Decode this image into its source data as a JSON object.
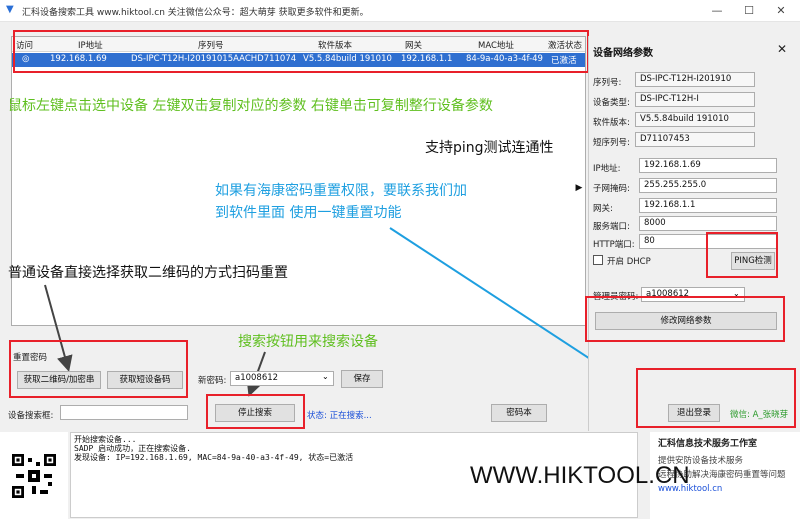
{
  "window": {
    "title": "汇科设备搜索工具  www.hiktool.cn  关注微信公众号：超大萌芽  获取更多软件和更新。",
    "minimize": "—",
    "maximize": "☐",
    "close": "✕"
  },
  "grid": {
    "columns": [
      "访问",
      "IP地址",
      "序列号",
      "软件版本",
      "网关",
      "MAC地址",
      "激活状态"
    ],
    "rows": [
      {
        "access": "◎",
        "ip": "192.168.1.69",
        "serial": "DS-IPC-T12H-I20191015AACHD711074",
        "version": "V5.5.84build 191010",
        "gateway": "192.168.1.1",
        "mac": "84-9a-40-a3-4f-49",
        "status": "已激活"
      }
    ]
  },
  "annotations": {
    "select_hint": "鼠标左键点击选中设备   左键双击复制对应的参数   右键单击可复制整行设备参数",
    "ping_hint": "支持ping测试连通性",
    "reset_hint_line1": "如果有海康密码重置权限，要联系我们加",
    "reset_hint_line2": "到软件里面  使用一键重置功能",
    "qr_hint": "普通设备直接选择获取二维码的方式扫码重置",
    "search_hint": "搜索按钮用来搜索设备",
    "watermark": "WWW.HIKTOOL.CN"
  },
  "panel": {
    "title": "设备网络参数",
    "close": "✕",
    "serial_label": "序列号:",
    "serial_value": "DS-IPC-T12H-I201910",
    "type_label": "设备类型:",
    "type_value": "DS-IPC-T12H-I",
    "version_label": "软件版本:",
    "version_value": "V5.5.84build 191010",
    "short_serial_label": "短序列号:",
    "short_serial_value": "D71107453",
    "ip_label": "IP地址:",
    "ip_value": "192.168.1.69",
    "mask_label": "子网掩码:",
    "mask_value": "255.255.255.0",
    "gateway_label": "网关:",
    "gateway_value": "192.168.1.1",
    "port_label": "服务端口:",
    "port_value": "8000",
    "http_label": "HTTP端口:",
    "http_value": "80",
    "dhcp_label": "开启 DHCP",
    "ping_button": "PING检测",
    "admin_pwd_label": "管理员密码:",
    "admin_pwd_value": "a1008612",
    "modify_button": "修改网络参数",
    "expand_arrow": "▶"
  },
  "reset": {
    "group_label": "重置密码",
    "get_qr_button": "获取二维码/加密串",
    "get_sms_button": "获取短设备码",
    "new_pwd_label": "新密码:",
    "new_pwd_value": "a1008612",
    "save_button": "保存"
  },
  "search": {
    "box_label": "设备搜索框:",
    "box_value": "",
    "stop_button": "停止搜索",
    "status_text": "状态: 正在搜索...",
    "pwdbook_button": "密码本",
    "logout_button": "退出登录",
    "wechat_text": "微信: A_张晓芽"
  },
  "log": {
    "lines": "开始搜索设备...\nSADP 启动成功，正在搜索设备.\n发现设备: IP=192.168.1.69, MAC=84-9a-40-a3-4f-49, 状态=已激活"
  },
  "studio": {
    "title": "汇科信息技术服务工作室",
    "line1": "提供安防设备技术服务",
    "line2": "远程协助解决海康密码重置等问题",
    "url": "www.hiktool.cn"
  },
  "colors": {
    "selection": "#2f6fd0",
    "annotation_red": "#e8202a",
    "annotation_green": "#5fbf1f",
    "annotation_blue": "#1e9fe0"
  }
}
